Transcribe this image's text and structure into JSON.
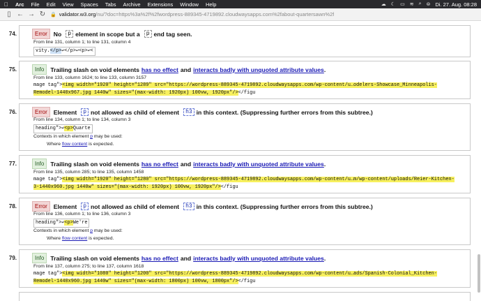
{
  "menubar": {
    "app": "Arc",
    "items": [
      "File",
      "Edit",
      "View",
      "Spaces",
      "Tabs",
      "Archive",
      "Extensions",
      "Window",
      "Help"
    ],
    "datetime": "Di. 27. Aug. 08:28"
  },
  "browser": {
    "url_domain": "validator.w3.org",
    "url_rest": "/nu/?doc=https%3a%2f%2fwordpress-889345-4719892.cloudwaysapps.com%2fabout-quartersawn%2f"
  },
  "messages": [
    {
      "num": "74.",
      "type": "Error",
      "t1": "No",
      "code1": "p",
      "t2": "element in scope but a",
      "code2": "p",
      "t3": "end tag seen.",
      "loc": "From line 131, column 1; to line 131, column 4",
      "ext_pre": "vity.",
      "ext_hl": "</p>",
      "ext_post": "↩</p>↩<p>↩<"
    },
    {
      "num": "75.",
      "type": "Info",
      "t1": "Trailing slash on void elements",
      "link1": "has no effect",
      "t2": "and",
      "link2": "interacts badly with unquoted attribute values",
      "t3": ".",
      "loc": "From line 133, column 1624; to line 133, column 3157",
      "ext_line1_pre": "mage tag\">",
      "ext_line1_hl": "<img width=\"1920\" height=\"1289\" src=\"https://wordpress-889345-4719892.cloudwaysapps.com/wp-content/u…odelers-Showcase_Minneapolis-",
      "ext_line2_hl": "Remodel-1440x967.jpg 1440w\" sizes=\"(max-width: 1920px) 100vw, 1920px\"/>",
      "ext_line2_post": "</figu"
    },
    {
      "num": "76.",
      "type": "Error",
      "t1": "Element",
      "code1": "p",
      "t2": "not allowed as child of element",
      "code2": "h3",
      "t3": "in this context. (Suppressing further errors from this subtree.)",
      "loc": "From line 134, column 1; to line 134, column 3",
      "ext_pre": "heading\">↩",
      "ext_hl": "<p>",
      "ext_post": "Quarte",
      "ctx1_pre": "Contexts in which element",
      "ctx1_link": "p",
      "ctx1_post": "may be used:",
      "ctx2_pre": "Where",
      "ctx2_link": "flow content",
      "ctx2_post": "is expected."
    },
    {
      "num": "77.",
      "type": "Info",
      "t1": "Trailing slash on void elements",
      "link1": "has no effect",
      "t2": "and",
      "link2": "interacts badly with unquoted attribute values",
      "t3": ".",
      "loc": "From line 135, column 285; to line 135, column 1458",
      "ext_line1_pre": "mage tag\">",
      "ext_line1_hl": "<img width=\"1920\" height=\"1280\" src=\"https://wordpress-889345-4719892.cloudwaysapps.com/wp-content/u…m/wp-content/uploads/Reier-Kitchen-",
      "ext_line2_hl": "3-1440x960.jpg 1440w\" sizes=\"(max-width: 1920px) 100vw, 1920px\"/>",
      "ext_line2_post": "</figu"
    },
    {
      "num": "78.",
      "type": "Error",
      "t1": "Element",
      "code1": "p",
      "t2": "not allowed as child of element",
      "code2": "h3",
      "t3": "in this context. (Suppressing further errors from this subtree.)",
      "loc": "From line 136, column 1; to line 136, column 3",
      "ext_pre": "heading\">↩",
      "ext_hl": "<p>",
      "ext_post": "We're ",
      "ctx1_pre": "Contexts in which element",
      "ctx1_link": "p",
      "ctx1_post": "may be used:",
      "ctx2_pre": "Where",
      "ctx2_link": "flow content",
      "ctx2_post": "is expected."
    },
    {
      "num": "79.",
      "type": "Info",
      "t1": "Trailing slash on void elements",
      "link1": "has no effect",
      "t2": "and",
      "link2": "interacts badly with unquoted attribute values",
      "t3": ".",
      "loc": "From line 137, column 275; to line 137, column 1618",
      "ext_line1_pre": "mage tag\">",
      "ext_line1_hl": "<img width=\"1080\" height=\"1200\" src=\"https://wordpress-889345-4719892.cloudwaysapps.com/wp-content/u…ads/Spanish-Colonial_Kitchen-",
      "ext_line2_hl": "Remodel-1440x960.jpg 1440w\" sizes=\"(max-width: 1800px) 100vw, 1800px\"/>",
      "ext_line2_post": "</figu"
    }
  ]
}
